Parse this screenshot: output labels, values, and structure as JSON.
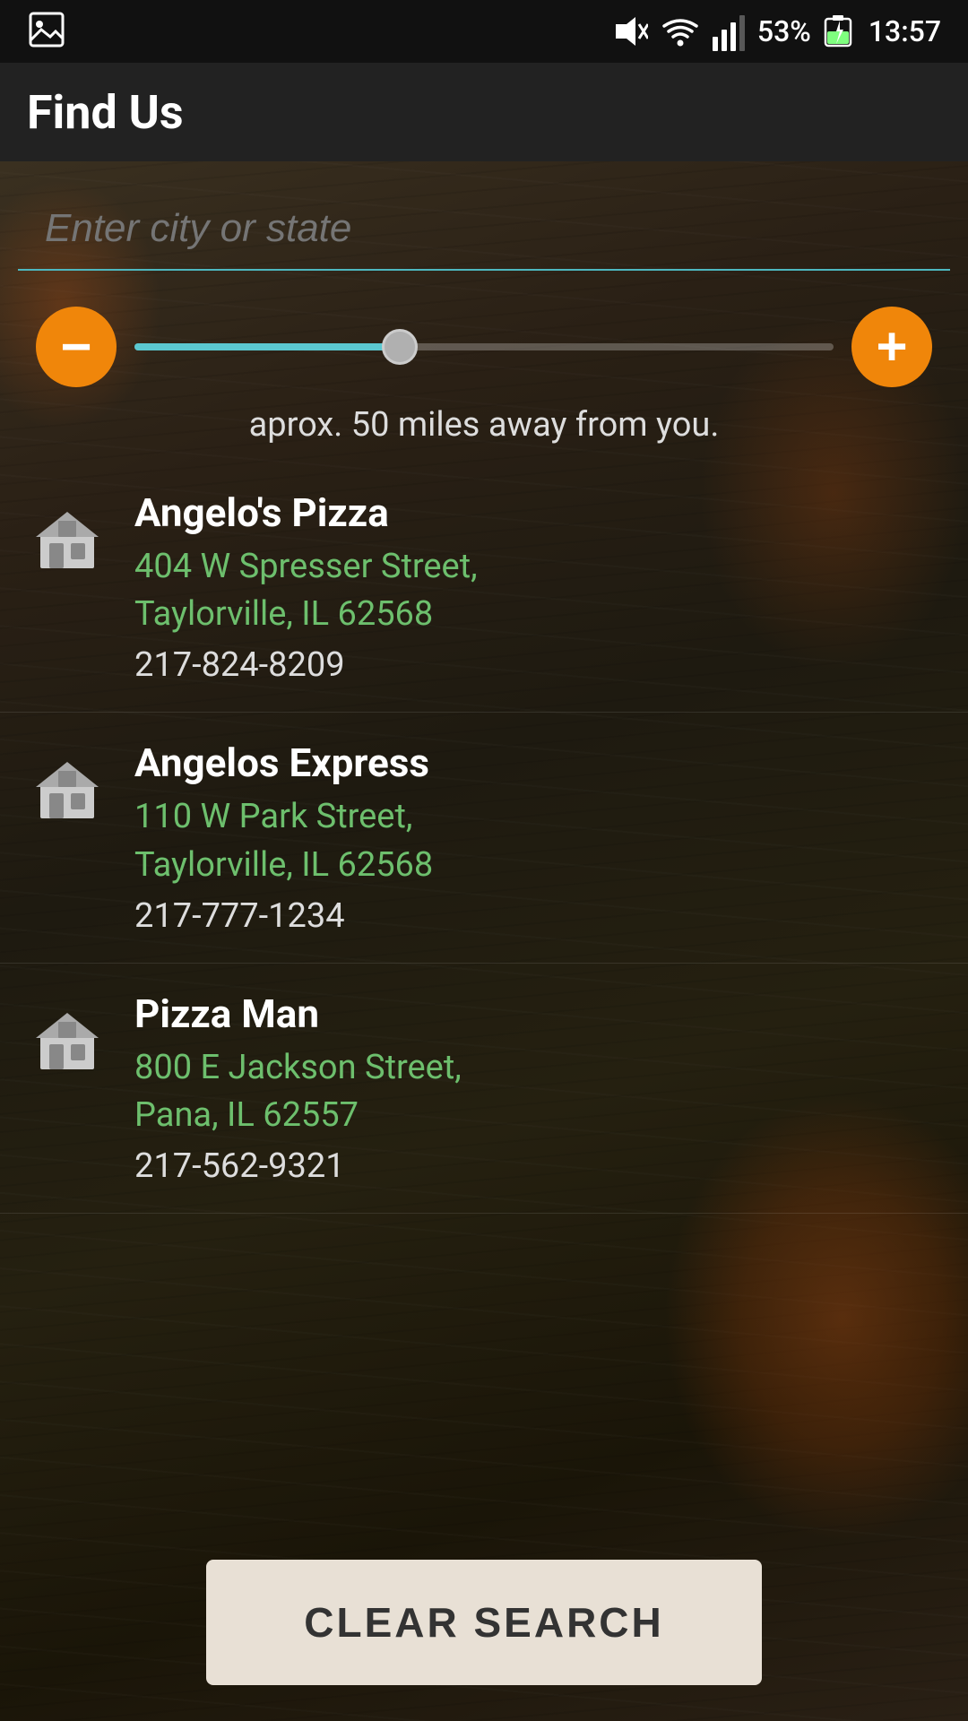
{
  "statusBar": {
    "time": "13:57",
    "battery": "53%",
    "signal": "signal",
    "wifi": "wifi",
    "mute": "mute"
  },
  "header": {
    "title": "Find Us"
  },
  "search": {
    "placeholder": "Enter city or state",
    "value": ""
  },
  "slider": {
    "decrementLabel": "−",
    "incrementLabel": "+",
    "distanceText": "aprox.  50  miles away from you.",
    "value": 50,
    "fillPercent": 38
  },
  "locations": [
    {
      "name": "Angelo's Pizza",
      "address": "404 W Spresser Street,\nTaylorville, IL 62568",
      "phone": "217-824-8209"
    },
    {
      "name": "Angelos Express",
      "address": "110 W Park Street,\nTaylorville, IL 62568",
      "phone": "217-777-1234"
    },
    {
      "name": "Pizza Man",
      "address": "800 E Jackson Street,\nPana, IL 62557",
      "phone": "217-562-9321"
    }
  ],
  "clearButton": {
    "label": "CLEAR SEARCH"
  },
  "colors": {
    "accent": "#f0860a",
    "addressGreen": "#6dbf6d",
    "searchBorder": "#4db8c0"
  }
}
